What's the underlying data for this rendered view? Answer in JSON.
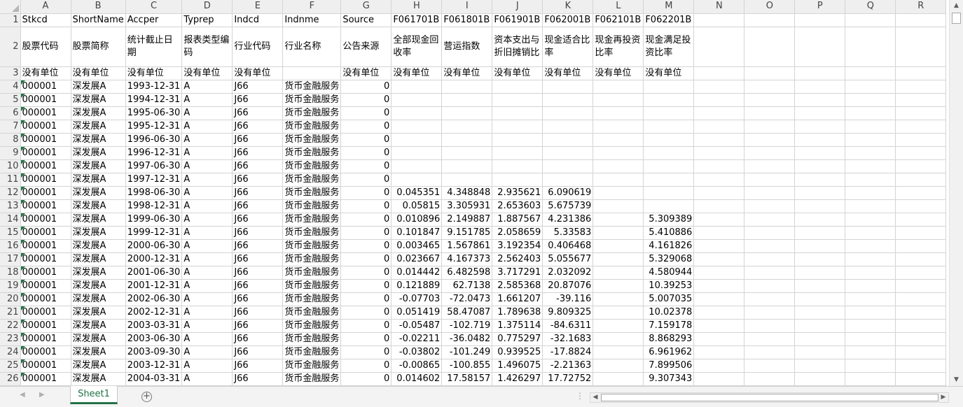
{
  "columns": [
    "A",
    "B",
    "C",
    "D",
    "E",
    "F",
    "G",
    "H",
    "I",
    "J",
    "K",
    "L",
    "M",
    "N",
    "O",
    "P",
    "Q",
    "R"
  ],
  "header_row1": [
    "Stkcd",
    "ShortName",
    "Accper",
    "Typrep",
    "Indcd",
    "Indnme",
    "Source",
    "F061701B",
    "F061801B",
    "F061901B",
    "F062001B",
    "F062101B",
    "F062201B",
    "",
    "",
    "",
    "",
    ""
  ],
  "header_row2": [
    "股票代码",
    "股票简称",
    "统计截止日期",
    "报表类型编码",
    "行业代码",
    "行业名称",
    "公告来源",
    "全部现金回收率",
    "营运指数",
    "资本支出与折旧摊销比",
    "现金适合比率",
    "现金再投资比率",
    "现金满足投资比率",
    "",
    "",
    "",
    "",
    ""
  ],
  "header_row3": [
    "没有单位",
    "没有单位",
    "没有单位",
    "没有单位",
    "没有单位",
    "",
    "没有单位",
    "没有单位",
    "没有单位",
    "没有单位",
    "没有单位",
    "没有单位",
    "没有单位",
    "",
    "",
    "",
    "",
    ""
  ],
  "data_rows": [
    [
      "000001",
      "深发展A",
      "1993-12-31",
      "A",
      "J66",
      "货币金融服务",
      "0",
      "",
      "",
      "",
      "",
      "",
      ""
    ],
    [
      "000001",
      "深发展A",
      "1994-12-31",
      "A",
      "J66",
      "货币金融服务",
      "0",
      "",
      "",
      "",
      "",
      "",
      ""
    ],
    [
      "000001",
      "深发展A",
      "1995-06-30",
      "A",
      "J66",
      "货币金融服务",
      "0",
      "",
      "",
      "",
      "",
      "",
      ""
    ],
    [
      "000001",
      "深发展A",
      "1995-12-31",
      "A",
      "J66",
      "货币金融服务",
      "0",
      "",
      "",
      "",
      "",
      "",
      ""
    ],
    [
      "000001",
      "深发展A",
      "1996-06-30",
      "A",
      "J66",
      "货币金融服务",
      "0",
      "",
      "",
      "",
      "",
      "",
      ""
    ],
    [
      "000001",
      "深发展A",
      "1996-12-31",
      "A",
      "J66",
      "货币金融服务",
      "0",
      "",
      "",
      "",
      "",
      "",
      ""
    ],
    [
      "000001",
      "深发展A",
      "1997-06-30",
      "A",
      "J66",
      "货币金融服务",
      "0",
      "",
      "",
      "",
      "",
      "",
      ""
    ],
    [
      "000001",
      "深发展A",
      "1997-12-31",
      "A",
      "J66",
      "货币金融服务",
      "0",
      "",
      "",
      "",
      "",
      "",
      ""
    ],
    [
      "000001",
      "深发展A",
      "1998-06-30",
      "A",
      "J66",
      "货币金融服务",
      "0",
      "0.045351",
      "4.348848",
      "2.935621",
      "6.090619",
      "",
      ""
    ],
    [
      "000001",
      "深发展A",
      "1998-12-31",
      "A",
      "J66",
      "货币金融服务",
      "0",
      "0.05815",
      "3.305931",
      "2.653603",
      "5.675739",
      "",
      ""
    ],
    [
      "000001",
      "深发展A",
      "1999-06-30",
      "A",
      "J66",
      "货币金融服务",
      "0",
      "0.010896",
      "2.149887",
      "1.887567",
      "4.231386",
      "",
      "5.309389"
    ],
    [
      "000001",
      "深发展A",
      "1999-12-31",
      "A",
      "J66",
      "货币金融服务",
      "0",
      "0.101847",
      "9.151785",
      "2.058659",
      "5.33583",
      "",
      "5.410886"
    ],
    [
      "000001",
      "深发展A",
      "2000-06-30",
      "A",
      "J66",
      "货币金融服务",
      "0",
      "0.003465",
      "1.567861",
      "3.192354",
      "0.406468",
      "",
      "4.161826"
    ],
    [
      "000001",
      "深发展A",
      "2000-12-31",
      "A",
      "J66",
      "货币金融服务",
      "0",
      "0.023667",
      "4.167373",
      "2.562403",
      "5.055677",
      "",
      "5.329068"
    ],
    [
      "000001",
      "深发展A",
      "2001-06-30",
      "A",
      "J66",
      "货币金融服务",
      "0",
      "0.014442",
      "6.482598",
      "3.717291",
      "2.032092",
      "",
      "4.580944"
    ],
    [
      "000001",
      "深发展A",
      "2001-12-31",
      "A",
      "J66",
      "货币金融服务",
      "0",
      "0.121889",
      "62.7138",
      "2.585368",
      "20.87076",
      "",
      "10.39253"
    ],
    [
      "000001",
      "深发展A",
      "2002-06-30",
      "A",
      "J66",
      "货币金融服务",
      "0",
      "-0.07703",
      "-72.0473",
      "1.661207",
      "-39.116",
      "",
      "5.007035"
    ],
    [
      "000001",
      "深发展A",
      "2002-12-31",
      "A",
      "J66",
      "货币金融服务",
      "0",
      "0.051419",
      "58.47087",
      "1.789638",
      "9.809325",
      "",
      "10.02378"
    ],
    [
      "000001",
      "深发展A",
      "2003-03-31",
      "A",
      "J66",
      "货币金融服务",
      "0",
      "-0.05487",
      "-102.719",
      "1.375114",
      "-84.6311",
      "",
      "7.159178"
    ],
    [
      "000001",
      "深发展A",
      "2003-06-30",
      "A",
      "J66",
      "货币金融服务",
      "0",
      "-0.02211",
      "-36.0482",
      "0.775297",
      "-32.1683",
      "",
      "8.868293"
    ],
    [
      "000001",
      "深发展A",
      "2003-09-30",
      "A",
      "J66",
      "货币金融服务",
      "0",
      "-0.03802",
      "-101.249",
      "0.939525",
      "-17.8824",
      "",
      "6.961962"
    ],
    [
      "000001",
      "深发展A",
      "2003-12-31",
      "A",
      "J66",
      "货币金融服务",
      "0",
      "-0.00865",
      "-100.855",
      "1.496075",
      "-2.21363",
      "",
      "7.899506"
    ],
    [
      "000001",
      "深发展A",
      "2004-03-31",
      "A",
      "J66",
      "货币金融服务",
      "0",
      "0.014602",
      "17.58157",
      "1.426297",
      "17.72752",
      "",
      "9.307343"
    ]
  ],
  "sheet_tab": "Sheet1",
  "add_sheet_symbol": "+",
  "icons": {
    "scroll_up": "▲",
    "scroll_down": "▼",
    "scroll_left": "◀",
    "scroll_right": "▶",
    "nav_prev": "◀",
    "nav_next": "▶",
    "split_dots": "⋮"
  },
  "colors": {
    "sheet_tab_accent": "#217346",
    "text_indicator": "#1e7145"
  }
}
